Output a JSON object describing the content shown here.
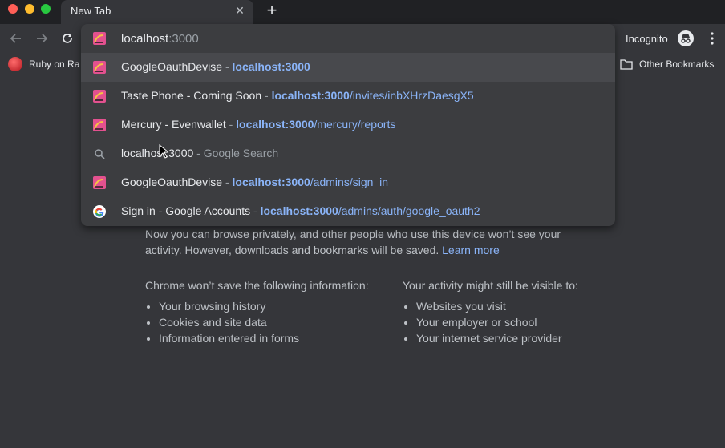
{
  "tab": {
    "title": "New Tab"
  },
  "toolbar": {
    "incognito_label": "Incognito"
  },
  "bookmarks": {
    "ruby_label": "Ruby on Ra",
    "other_label": "Other Bookmarks"
  },
  "omnibox": {
    "typed": "localhost",
    "autocomplete": ":3000",
    "suggestions": [
      {
        "title": "GoogleOauthDevise",
        "sep": " - ",
        "host": "localhost:3000",
        "path": "",
        "icon": "rails-icon",
        "selected": true
      },
      {
        "title": "Taste Phone - Coming Soon",
        "sep": " - ",
        "host": "localhost:3000",
        "path": "/invites/inbXHrzDaesgX5",
        "icon": "rails-icon"
      },
      {
        "title": "Mercury - Evenwallet",
        "sep": " - ",
        "host": "localhost:3000",
        "path": "/mercury/reports",
        "icon": "rails-icon"
      },
      {
        "title": "localhost:3000",
        "sep": " - ",
        "desc": "Google Search",
        "icon": "search-icon"
      },
      {
        "title": "GoogleOauthDevise",
        "sep": " - ",
        "host": "localhost:3000",
        "path": "/admins/sign_in",
        "icon": "rails-icon"
      },
      {
        "title": "Sign in - Google Accounts",
        "sep": " - ",
        "host": "localhost:3000",
        "path": "/admins/auth/google_oauth2",
        "icon": "google-icon"
      }
    ]
  },
  "page": {
    "intro_text": "Now you can browse privately, and other people who use this device won’t see your activity. However, downloads and bookmarks will be saved. ",
    "learn_more": "Learn more",
    "left_head": "Chrome won’t save the following information:",
    "left_items": [
      "Your browsing history",
      "Cookies and site data",
      "Information entered in forms"
    ],
    "right_head": "Your activity might still be visible to:",
    "right_items": [
      "Websites you visit",
      "Your employer or school",
      "Your internet service provider"
    ]
  },
  "colors": {
    "link": "#8ab4f8",
    "background": "#35363a",
    "frame": "#202124"
  }
}
